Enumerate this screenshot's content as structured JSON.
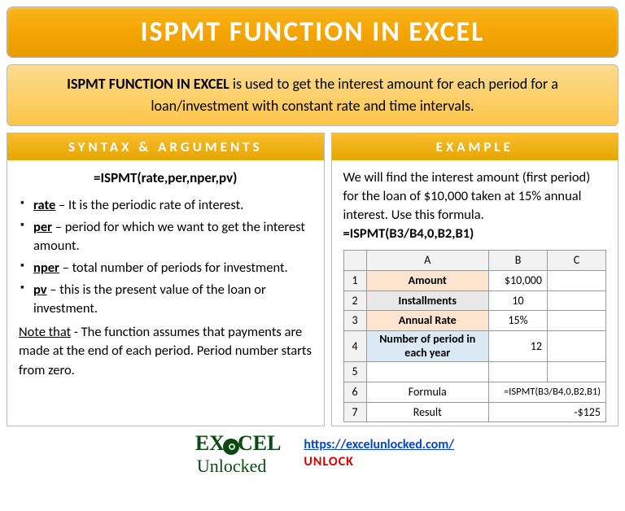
{
  "title": "ISPMT FUNCTION IN EXCEL",
  "description": {
    "lead": "ISPMT FUNCTION IN EXCEL",
    "rest": " is used to get the interest amount for each period for a loan/investment with constant rate and time intervals."
  },
  "syntax": {
    "header": "SYNTAX & ARGUMENTS",
    "formula": "=ISPMT(rate,per,nper,pv)",
    "args": [
      {
        "name": "rate",
        "desc": " – It is the periodic rate of interest."
      },
      {
        "name": "per",
        "desc": " – period for which we want to get the interest amount."
      },
      {
        "name": "nper",
        "desc": " – total number of periods for investment."
      },
      {
        "name": "pv",
        "desc": " – this is the present value of the loan or investment."
      }
    ],
    "note_lead": "Note that",
    "note_rest": " - The function assumes that payments are made at the end of each period. Period number starts from zero."
  },
  "example": {
    "header": "EXAMPLE",
    "text": "We will find the interest amount (first period) for the loan of $10,000 taken at 15% annual interest. Use this formula.",
    "formula": "=ISPMT(B3/B4,0,B2,B1)",
    "cols": [
      "",
      "A",
      "B",
      "C"
    ],
    "rows": [
      {
        "n": "1",
        "a_class": "labelcell-peach",
        "a": "Amount",
        "b": "$10,000",
        "b_class": "valright",
        "c": ""
      },
      {
        "n": "2",
        "a_class": "labelcell-gray",
        "a": "Installments",
        "b": "10",
        "b_class": "",
        "c": ""
      },
      {
        "n": "3",
        "a_class": "labelcell-peach",
        "a": "Annual Rate",
        "b": "15%",
        "b_class": "",
        "c": ""
      },
      {
        "n": "4",
        "a_class": "labelcell-blue",
        "a": "Number of period in each year",
        "b": "12",
        "b_class": "valright",
        "c": ""
      },
      {
        "n": "5",
        "a_class": "",
        "a": "",
        "b": "",
        "b_class": "",
        "c": ""
      },
      {
        "n": "6",
        "a_class": "",
        "a": "Formula",
        "b_colspan": 2,
        "b": "=ISPMT(B3/B4,0,B2,B1)",
        "b_class": "formula-cell valright"
      },
      {
        "n": "7",
        "a_class": "",
        "a": "Result",
        "b_colspan": 2,
        "b": "-$125",
        "b_class": "valright"
      }
    ]
  },
  "footer": {
    "logo_main": "E   CEL",
    "logo_sub": "Unlocked",
    "url": "https://excelunlocked.com/",
    "tag": "UNLOCK"
  }
}
